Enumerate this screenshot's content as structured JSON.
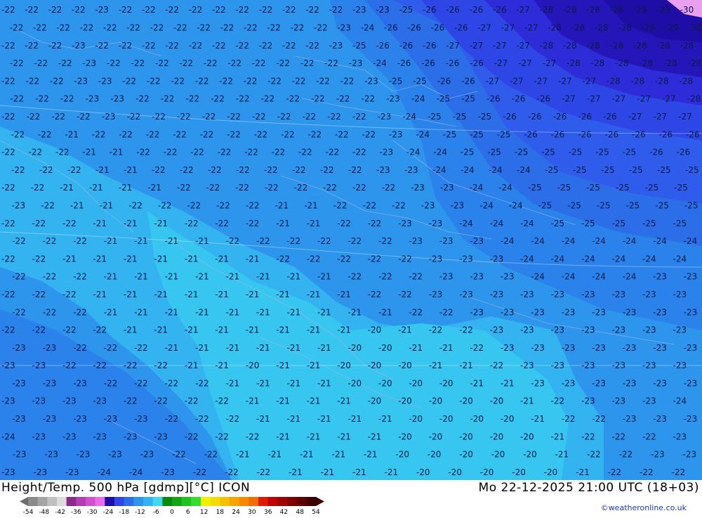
{
  "map": {
    "field": "height-temperature",
    "level": "500 hPa",
    "palette_note": "temperature shading in blue tones",
    "colors": {
      "t_minus20": "#36c6f0",
      "t_minus21": "#33b3f0",
      "t_minus22": "#2d95ec",
      "t_minus23": "#2a82ea",
      "t_minus24": "#2b6ee8",
      "t_minus25": "#2f5cea",
      "t_minus26": "#2f46e6",
      "t_minus27": "#2e2bd8",
      "t_minus28": "#2416b8",
      "t_minus29": "#1e0ea5",
      "t_minus30": "#e9a0f0"
    },
    "rows": [
      "22 22 22 22 23 22 22 22 22 22 22 22 22 22 22 23 23 25 26 26 26 26 27 28 28 28 28 29 29 30",
      "22 22 22 22 22 22 22 22 22 22 22 22 22 22 23 24 26 26 26 26 27 27 27 28 28 28 28 29 29 30",
      "22 22 22 23 22 22 22 22 22 22 22 22 22 22 23 25 26 26 26 27 27 27 27 28 28 28 28 28 28 28",
      "22 22 22 23 22 22 22 22 22 22 22 22 22 22 23 24 26 26 26 26 27 27 27 28 28 28 28 28 28",
      "22 22 22 23 23 22 22 22 22 22 22 22 22 22 22 23 25 25 26 26 27 27 27 27 27 28 28 28 28",
      "22 22 22 23 23 22 22 22 22 22 22 22 22 22 22 23 24 25 25 26 26 26 27 27 27 27 27 28",
      "22 22 22 22 23 22 22 22 22 22 22 22 22 22 22 23 24 25 25 25 26 26 26 26 26 27 27 27",
      "22 22 21 22 22 22 22 22 22 22 22 22 22 22 23 24 25 25 25 26 26 26 26 26 26 26",
      "22 22 22 21 21 22 22 22 22 22 22 22 22 22 23 24 24 25 25 25 25 25 25 25 26 26",
      "22 22 22 21 21 22 22 22 22 22 22 22 22 23 23 24 24 24 24 25 25 25 25 25 25",
      "22 22 21 21 21 21 22 22 22 22 22 22 22 22 23 23 24 24 25 25 25 25 25 25",
      "23 22 21 21 22 22 22 22 22 21 21 22 22 22 23 23 24 24 25 25 25 25 25 25",
      "22 22 22 21 21 21 22 22 22 21 21 22 22 23 23 24 24 24 25 25 25 25 25",
      "22 22 22 21 21 21 21 22 22 22 22 22 22 23 23 23 24 24 24 24 24 24 24",
      "22 22 21 21 21 21 21 21 21 22 22 22 22 22 23 23 23 24 24 24 24 24 24",
      "22 22 22 21 21 21 21 21 21 21 21 22 22 22 23 23 23 24 24 24 24 23 23",
      "22 22 22 21 21 21 21 21 21 21 21 21 22 22 23 23 23 23 23 23 23 23 23",
      "22 22 22 21 21 21 21 21 21 21 21 21 21 22 22 23 23 23 23 23 23 23 23",
      "22 22 22 22 21 21 21 21 21 21 21 21 20 21 22 22 23 23 23 23 23 23 23",
      "23 23 22 22 22 21 21 21 21 21 21 20 20 21 21 22 23 23 23 23 23 23 23",
      "23 23 22 22 22 22 21 21 20 21 21 20 20 20 21 21 22 23 23 23 23 23 23",
      "23 23 23 22 22 22 22 21 21 21 21 20 20 20 20 21 21 23 23 23 23 23 23",
      "23 23 23 23 22 22 22 22 21 21 21 21 20 20 20 20 20 21 22 23 23 23 24",
      "23 23 23 23 23 22 22 22 21 21 21 21 21 20 20 20 20 21 22 22 23 23 23",
      "24 23 23 23 23 23 22 22 22 21 21 21 21 20 20 20 20 20 21 22 22 22 23",
      "23 23 23 23 23 22 22 21 21 21 21 21 20 20 20 20 20 21 22 22 23 23",
      "23 23 23 24 24 23 22 22 22 21 21 21 21 20 20 20 20 20 21 22 22 22"
    ]
  },
  "header": {
    "title": "Height/Temp. 500 hPa [gdmp][°C] ICON",
    "datetime": "Mo 22-12-2025 21:00 UTC (18+03)",
    "credit": "©weatheronline.co.uk"
  },
  "legend": {
    "ticks": [
      "-54",
      "-48",
      "-42",
      "-36",
      "-30",
      "-24",
      "-18",
      "-12",
      "-6",
      "0",
      "6",
      "12",
      "18",
      "24",
      "30",
      "36",
      "42",
      "48",
      "54"
    ],
    "swatches": [
      "#8a8a8a",
      "#a4a4a4",
      "#c0c0c0",
      "#dcdcdc",
      "#8b2a8b",
      "#b43cb4",
      "#d24fd2",
      "#e96ce9",
      "#1e0ea5",
      "#2f46e6",
      "#2b6ee8",
      "#2d95ec",
      "#33b3f0",
      "#40d8f5",
      "#0a8a0a",
      "#13a513",
      "#1fc21f",
      "#34dc34",
      "#f0f000",
      "#f4dc00",
      "#f6c000",
      "#f8a400",
      "#f58a00",
      "#f06e00",
      "#e01a00",
      "#c00000",
      "#a00000",
      "#800000",
      "#600000",
      "#400000"
    ]
  }
}
